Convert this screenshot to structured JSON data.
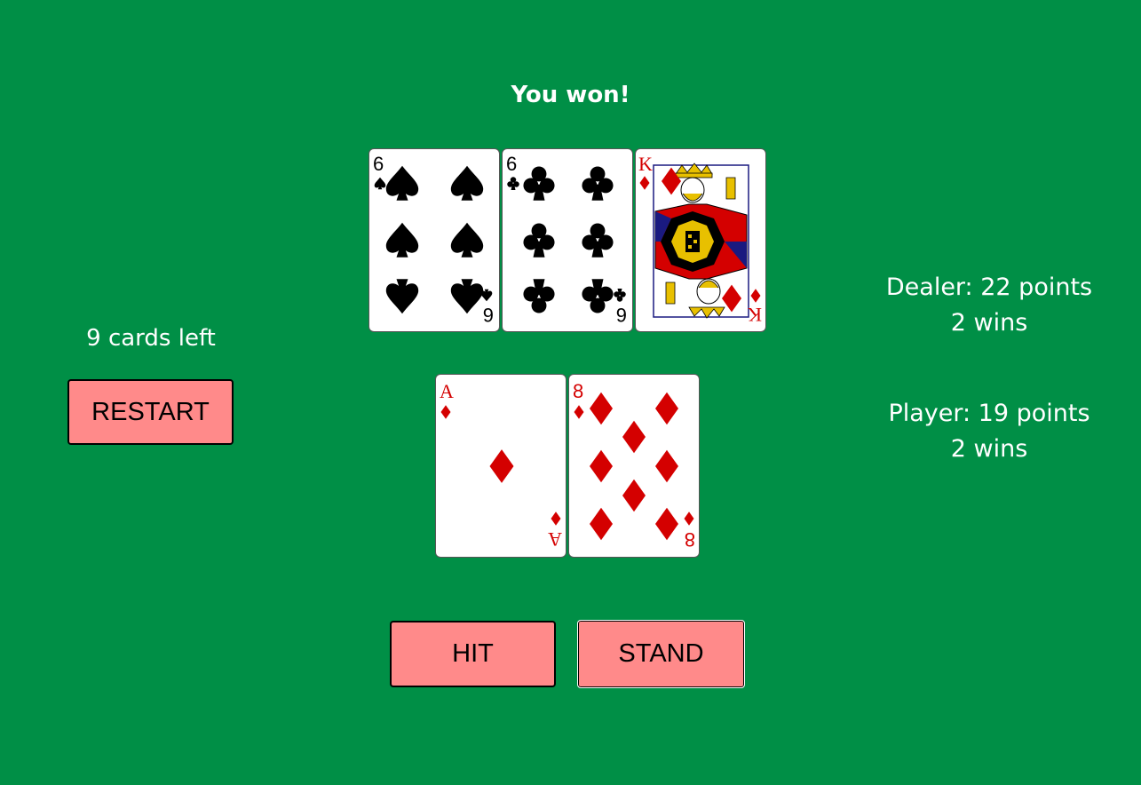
{
  "status": "You won!",
  "deck": {
    "cards_left_text": "9 cards left"
  },
  "buttons": {
    "restart": "RESTART",
    "hit": "HIT",
    "stand": "STAND"
  },
  "dealer": {
    "points_text": "Dealer: 22 points",
    "wins_text": "2 wins"
  },
  "player": {
    "points_text": "Player: 19 points",
    "wins_text": "2 wins"
  },
  "dealer_hand": [
    {
      "rank": "6",
      "suit": "spades"
    },
    {
      "rank": "6",
      "suit": "clubs"
    },
    {
      "rank": "K",
      "suit": "diamonds"
    }
  ],
  "player_hand": [
    {
      "rank": "A",
      "suit": "diamonds"
    },
    {
      "rank": "8",
      "suit": "diamonds"
    }
  ],
  "colors": {
    "table": "#008f46",
    "button": "#ff8a8a",
    "red_suit": "#d40000",
    "black_suit": "#000000"
  }
}
